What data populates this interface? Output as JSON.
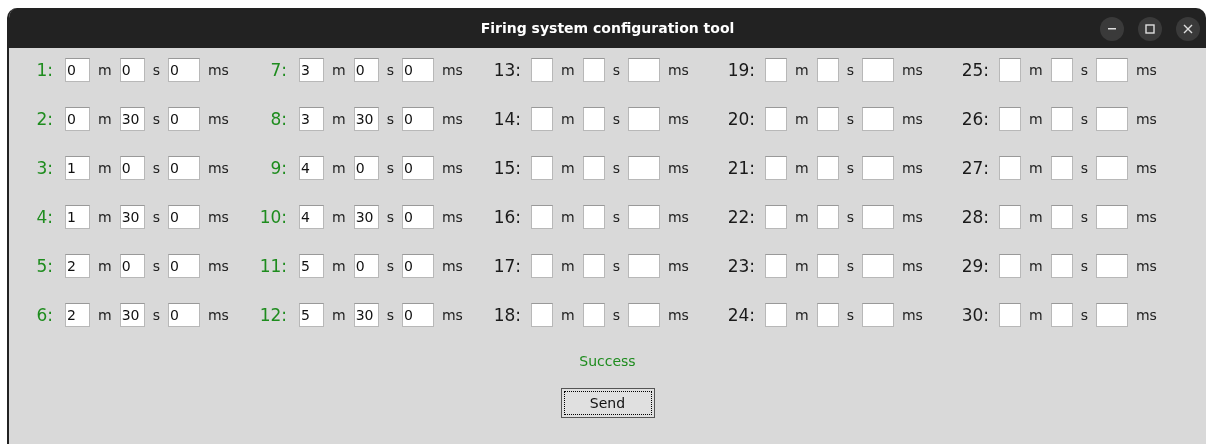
{
  "window": {
    "title": "Firing system configuration tool",
    "controls": [
      {
        "kind": "minimize"
      },
      {
        "kind": "maximize"
      },
      {
        "kind": "close"
      }
    ]
  },
  "channels": [
    {
      "label": "1:",
      "configured": true,
      "fields": [
        {
          "value": "0",
          "unit": "m"
        },
        {
          "value": "0",
          "unit": "s"
        },
        {
          "value": "0",
          "unit": "ms"
        }
      ]
    },
    {
      "label": "2:",
      "configured": true,
      "fields": [
        {
          "value": "0",
          "unit": "m"
        },
        {
          "value": "30",
          "unit": "s"
        },
        {
          "value": "0",
          "unit": "ms"
        }
      ]
    },
    {
      "label": "3:",
      "configured": true,
      "fields": [
        {
          "value": "1",
          "unit": "m"
        },
        {
          "value": "0",
          "unit": "s"
        },
        {
          "value": "0",
          "unit": "ms"
        }
      ]
    },
    {
      "label": "4:",
      "configured": true,
      "fields": [
        {
          "value": "1",
          "unit": "m"
        },
        {
          "value": "30",
          "unit": "s"
        },
        {
          "value": "0",
          "unit": "ms"
        }
      ]
    },
    {
      "label": "5:",
      "configured": true,
      "fields": [
        {
          "value": "2",
          "unit": "m"
        },
        {
          "value": "0",
          "unit": "s"
        },
        {
          "value": "0",
          "unit": "ms"
        }
      ]
    },
    {
      "label": "6:",
      "configured": true,
      "fields": [
        {
          "value": "2",
          "unit": "m"
        },
        {
          "value": "30",
          "unit": "s"
        },
        {
          "value": "0",
          "unit": "ms"
        }
      ]
    },
    {
      "label": "7:",
      "configured": true,
      "fields": [
        {
          "value": "3",
          "unit": "m"
        },
        {
          "value": "0",
          "unit": "s"
        },
        {
          "value": "0",
          "unit": "ms"
        }
      ]
    },
    {
      "label": "8:",
      "configured": true,
      "fields": [
        {
          "value": "3",
          "unit": "m"
        },
        {
          "value": "30",
          "unit": "s"
        },
        {
          "value": "0",
          "unit": "ms"
        }
      ]
    },
    {
      "label": "9:",
      "configured": true,
      "fields": [
        {
          "value": "4",
          "unit": "m"
        },
        {
          "value": "0",
          "unit": "s"
        },
        {
          "value": "0",
          "unit": "ms"
        }
      ]
    },
    {
      "label": "10:",
      "configured": true,
      "fields": [
        {
          "value": "4",
          "unit": "m"
        },
        {
          "value": "30",
          "unit": "s"
        },
        {
          "value": "0",
          "unit": "ms"
        }
      ]
    },
    {
      "label": "11:",
      "configured": true,
      "fields": [
        {
          "value": "5",
          "unit": "m"
        },
        {
          "value": "0",
          "unit": "s"
        },
        {
          "value": "0",
          "unit": "ms"
        }
      ]
    },
    {
      "label": "12:",
      "configured": true,
      "fields": [
        {
          "value": "5",
          "unit": "m"
        },
        {
          "value": "30",
          "unit": "s"
        },
        {
          "value": "0",
          "unit": "ms"
        }
      ]
    },
    {
      "label": "13:",
      "configured": false,
      "fields": [
        {
          "unit": "m"
        },
        {
          "unit": "s"
        },
        {
          "unit": "ms"
        }
      ]
    },
    {
      "label": "14:",
      "configured": false,
      "fields": [
        {
          "unit": "m"
        },
        {
          "unit": "s"
        },
        {
          "unit": "ms"
        }
      ]
    },
    {
      "label": "15:",
      "configured": false,
      "fields": [
        {
          "unit": "m"
        },
        {
          "unit": "s"
        },
        {
          "unit": "ms"
        }
      ]
    },
    {
      "label": "16:",
      "configured": false,
      "fields": [
        {
          "unit": "m"
        },
        {
          "unit": "s"
        },
        {
          "unit": "ms"
        }
      ]
    },
    {
      "label": "17:",
      "configured": false,
      "fields": [
        {
          "unit": "m"
        },
        {
          "unit": "s"
        },
        {
          "unit": "ms"
        }
      ]
    },
    {
      "label": "18:",
      "configured": false,
      "fields": [
        {
          "unit": "m"
        },
        {
          "unit": "s"
        },
        {
          "unit": "ms"
        }
      ]
    },
    {
      "label": "19:",
      "configured": false,
      "fields": [
        {
          "unit": "m"
        },
        {
          "unit": "s"
        },
        {
          "unit": "ms"
        }
      ]
    },
    {
      "label": "20:",
      "configured": false,
      "fields": [
        {
          "unit": "m"
        },
        {
          "unit": "s"
        },
        {
          "unit": "ms"
        }
      ]
    },
    {
      "label": "21:",
      "configured": false,
      "fields": [
        {
          "unit": "m"
        },
        {
          "unit": "s"
        },
        {
          "unit": "ms"
        }
      ]
    },
    {
      "label": "22:",
      "configured": false,
      "fields": [
        {
          "unit": "m"
        },
        {
          "unit": "s"
        },
        {
          "unit": "ms"
        }
      ]
    },
    {
      "label": "23:",
      "configured": false,
      "fields": [
        {
          "unit": "m"
        },
        {
          "unit": "s"
        },
        {
          "unit": "ms"
        }
      ]
    },
    {
      "label": "24:",
      "configured": false,
      "fields": [
        {
          "unit": "m"
        },
        {
          "unit": "s"
        },
        {
          "unit": "ms"
        }
      ]
    },
    {
      "label": "25:",
      "configured": false,
      "fields": [
        {
          "unit": "m"
        },
        {
          "unit": "s"
        },
        {
          "unit": "ms"
        }
      ]
    },
    {
      "label": "26:",
      "configured": false,
      "fields": [
        {
          "unit": "m"
        },
        {
          "unit": "s"
        },
        {
          "unit": "ms"
        }
      ]
    },
    {
      "label": "27:",
      "configured": false,
      "fields": [
        {
          "unit": "m"
        },
        {
          "unit": "s"
        },
        {
          "unit": "ms"
        }
      ]
    },
    {
      "label": "28:",
      "configured": false,
      "fields": [
        {
          "unit": "m"
        },
        {
          "unit": "s"
        },
        {
          "unit": "ms"
        }
      ]
    },
    {
      "label": "29:",
      "configured": false,
      "fields": [
        {
          "unit": "m"
        },
        {
          "unit": "s"
        },
        {
          "unit": "ms"
        }
      ]
    },
    {
      "label": "30:",
      "configured": false,
      "fields": [
        {
          "unit": "m"
        },
        {
          "unit": "s"
        },
        {
          "unit": "ms"
        }
      ]
    }
  ],
  "status": {
    "text": "Success",
    "kind": "success"
  },
  "buttons": [
    {
      "label": "Send",
      "focused": true
    }
  ]
}
